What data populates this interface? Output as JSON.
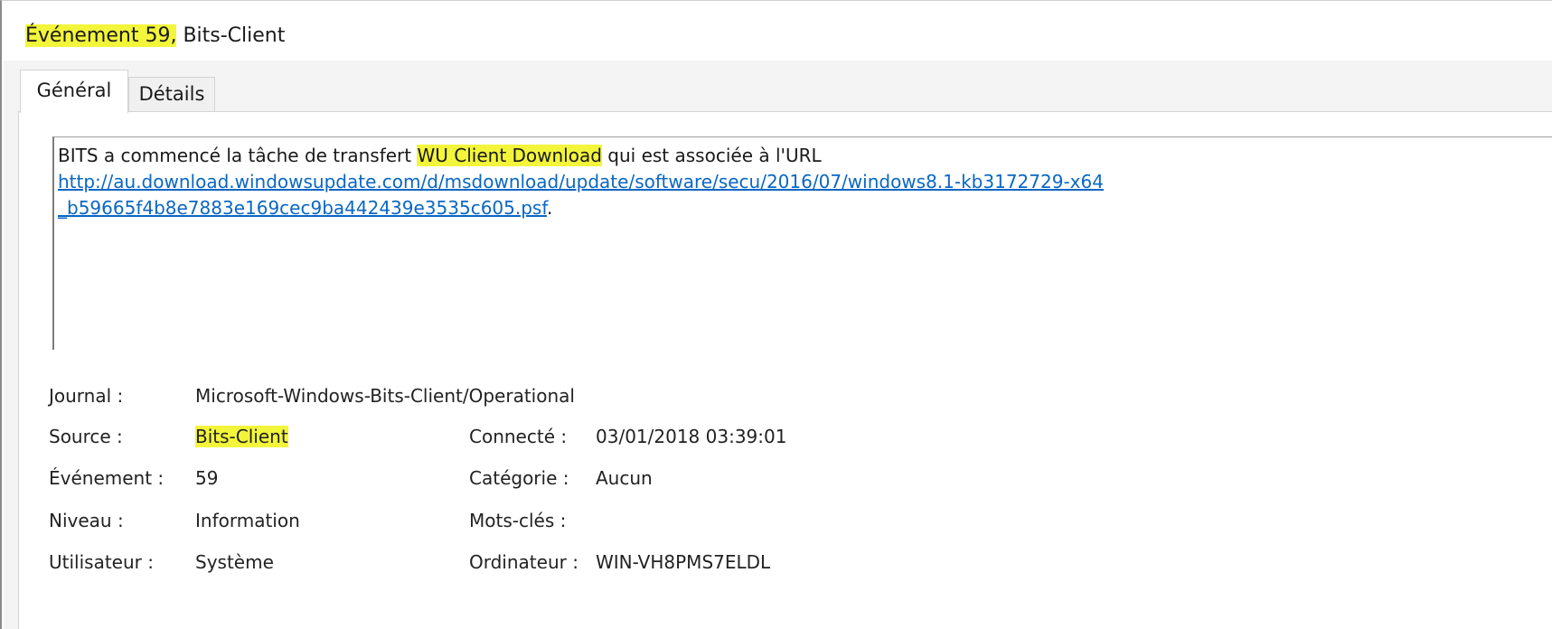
{
  "window": {
    "title_highlight": "Événement 59,",
    "title_rest": " Bits-Client"
  },
  "tabs": [
    {
      "label": "Général",
      "active": true
    },
    {
      "label": "Détails",
      "active": false
    }
  ],
  "description": {
    "line1_before": "BITS a commencé la tâche de transfert ",
    "line1_highlight": "WU Client Download",
    "line1_after": " qui est associée à l'URL",
    "url_line1": "http://au.download.windowsupdate.com/d/msdownload/update/software/secu/2016/07/windows8.1-kb3172729-x64",
    "url_line2": "_b59665f4b8e7883e169cec9ba442439e3535c605.psf",
    "url_suffix": "."
  },
  "properties": {
    "journal": {
      "label": "Journal :",
      "value": "Microsoft-Windows-Bits-Client/Operational"
    },
    "source": {
      "label": "Source :",
      "value": "Bits-Client"
    },
    "connecte": {
      "label": "Connecté :",
      "value": "03/01/2018 03:39:01"
    },
    "evenement": {
      "label": "Événement :",
      "value": "59"
    },
    "categorie": {
      "label": "Catégorie :",
      "value": "Aucun"
    },
    "niveau": {
      "label": "Niveau :",
      "value": "Information"
    },
    "mots_cles": {
      "label": "Mots-clés :",
      "value": ""
    },
    "utilisateur": {
      "label": "Utilisateur :",
      "value": "Système"
    },
    "ordinateur": {
      "label": "Ordinateur :",
      "value": "WIN-VH8PMS7ELDL"
    }
  },
  "colors": {
    "highlight": "#f3f53a",
    "link": "#0a67c4"
  }
}
